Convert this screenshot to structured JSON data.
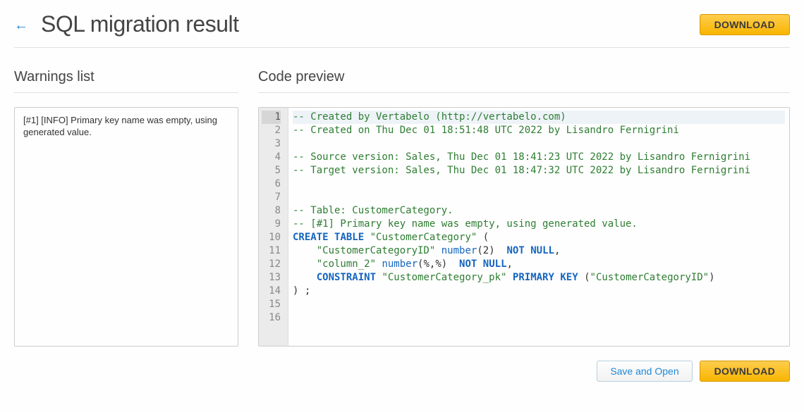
{
  "header": {
    "title": "SQL migration result",
    "download_label": "DOWNLOAD"
  },
  "warnings": {
    "title": "Warnings list",
    "items": [
      "[#1] [INFO] Primary key name was empty, using generated value."
    ]
  },
  "code": {
    "title": "Code preview",
    "active_line": 1,
    "lines": [
      {
        "n": 1,
        "tokens": [
          {
            "t": "-- Created by Vertabelo (http://vertabelo.com)",
            "c": "c-comment"
          }
        ]
      },
      {
        "n": 2,
        "tokens": [
          {
            "t": "-- Created on Thu Dec 01 18:51:48 UTC 2022 by Lisandro Fernigrini",
            "c": "c-comment"
          }
        ]
      },
      {
        "n": 3,
        "tokens": []
      },
      {
        "n": 4,
        "tokens": [
          {
            "t": "-- Source version: Sales, Thu Dec 01 18:41:23 UTC 2022 by Lisandro Fernigrini",
            "c": "c-comment"
          }
        ]
      },
      {
        "n": 5,
        "tokens": [
          {
            "t": "-- Target version: Sales, Thu Dec 01 18:47:32 UTC 2022 by Lisandro Fernigrini",
            "c": "c-comment"
          }
        ]
      },
      {
        "n": 6,
        "tokens": []
      },
      {
        "n": 7,
        "tokens": []
      },
      {
        "n": 8,
        "tokens": [
          {
            "t": "-- Table: CustomerCategory.",
            "c": "c-comment"
          }
        ]
      },
      {
        "n": 9,
        "tokens": [
          {
            "t": "-- [#1] Primary key name was empty, using generated value.",
            "c": "c-comment"
          }
        ]
      },
      {
        "n": 10,
        "tokens": [
          {
            "t": "CREATE",
            "c": "c-keyword"
          },
          {
            "t": " ",
            "c": ""
          },
          {
            "t": "TABLE",
            "c": "c-keyword"
          },
          {
            "t": " ",
            "c": ""
          },
          {
            "t": "\"CustomerCategory\"",
            "c": "c-string"
          },
          {
            "t": " (",
            "c": "c-punct"
          }
        ]
      },
      {
        "n": 11,
        "tokens": [
          {
            "t": "    ",
            "c": ""
          },
          {
            "t": "\"CustomerCategoryID\"",
            "c": "c-string"
          },
          {
            "t": " ",
            "c": ""
          },
          {
            "t": "number",
            "c": "c-type"
          },
          {
            "t": "(",
            "c": "c-punct"
          },
          {
            "t": "2",
            "c": ""
          },
          {
            "t": ")  ",
            "c": "c-punct"
          },
          {
            "t": "NOT",
            "c": "c-keyword"
          },
          {
            "t": " ",
            "c": ""
          },
          {
            "t": "NULL",
            "c": "c-keyword"
          },
          {
            "t": ",",
            "c": "c-punct"
          }
        ]
      },
      {
        "n": 12,
        "tokens": [
          {
            "t": "    ",
            "c": ""
          },
          {
            "t": "\"column_2\"",
            "c": "c-string"
          },
          {
            "t": " ",
            "c": ""
          },
          {
            "t": "number",
            "c": "c-type"
          },
          {
            "t": "(%,%)  ",
            "c": "c-punct"
          },
          {
            "t": "NOT",
            "c": "c-keyword"
          },
          {
            "t": " ",
            "c": ""
          },
          {
            "t": "NULL",
            "c": "c-keyword"
          },
          {
            "t": ",",
            "c": "c-punct"
          }
        ]
      },
      {
        "n": 13,
        "tokens": [
          {
            "t": "    ",
            "c": ""
          },
          {
            "t": "CONSTRAINT",
            "c": "c-keyword"
          },
          {
            "t": " ",
            "c": ""
          },
          {
            "t": "\"CustomerCategory_pk\"",
            "c": "c-string"
          },
          {
            "t": " ",
            "c": ""
          },
          {
            "t": "PRIMARY",
            "c": "c-keyword"
          },
          {
            "t": " ",
            "c": ""
          },
          {
            "t": "KEY",
            "c": "c-keyword"
          },
          {
            "t": " (",
            "c": "c-punct"
          },
          {
            "t": "\"CustomerCategoryID\"",
            "c": "c-string"
          },
          {
            "t": ")",
            "c": "c-punct"
          }
        ]
      },
      {
        "n": 14,
        "tokens": [
          {
            "t": ") ;",
            "c": "c-punct"
          }
        ]
      },
      {
        "n": 15,
        "tokens": []
      },
      {
        "n": 16,
        "tokens": []
      }
    ]
  },
  "footer": {
    "save_and_open_label": "Save and Open",
    "download_label": "DOWNLOAD"
  }
}
